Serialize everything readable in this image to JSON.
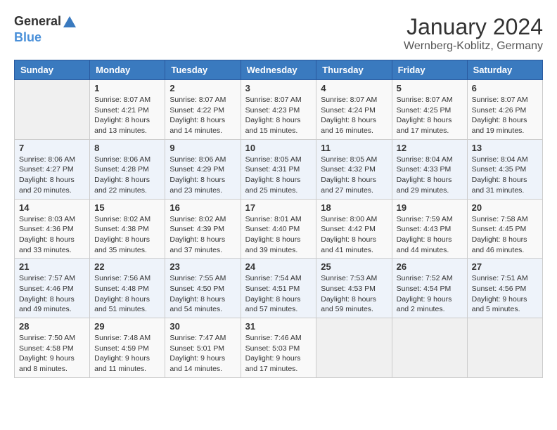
{
  "header": {
    "logo_general": "General",
    "logo_blue": "Blue",
    "month_title": "January 2024",
    "location": "Wernberg-Koblitz, Germany"
  },
  "days_of_week": [
    "Sunday",
    "Monday",
    "Tuesday",
    "Wednesday",
    "Thursday",
    "Friday",
    "Saturday"
  ],
  "weeks": [
    [
      {
        "day": "",
        "info": ""
      },
      {
        "day": "1",
        "info": "Sunrise: 8:07 AM\nSunset: 4:21 PM\nDaylight: 8 hours\nand 13 minutes."
      },
      {
        "day": "2",
        "info": "Sunrise: 8:07 AM\nSunset: 4:22 PM\nDaylight: 8 hours\nand 14 minutes."
      },
      {
        "day": "3",
        "info": "Sunrise: 8:07 AM\nSunset: 4:23 PM\nDaylight: 8 hours\nand 15 minutes."
      },
      {
        "day": "4",
        "info": "Sunrise: 8:07 AM\nSunset: 4:24 PM\nDaylight: 8 hours\nand 16 minutes."
      },
      {
        "day": "5",
        "info": "Sunrise: 8:07 AM\nSunset: 4:25 PM\nDaylight: 8 hours\nand 17 minutes."
      },
      {
        "day": "6",
        "info": "Sunrise: 8:07 AM\nSunset: 4:26 PM\nDaylight: 8 hours\nand 19 minutes."
      }
    ],
    [
      {
        "day": "7",
        "info": ""
      },
      {
        "day": "8",
        "info": "Sunrise: 8:06 AM\nSunset: 4:28 PM\nDaylight: 8 hours\nand 22 minutes."
      },
      {
        "day": "9",
        "info": "Sunrise: 8:06 AM\nSunset: 4:29 PM\nDaylight: 8 hours\nand 23 minutes."
      },
      {
        "day": "10",
        "info": "Sunrise: 8:05 AM\nSunset: 4:31 PM\nDaylight: 8 hours\nand 25 minutes."
      },
      {
        "day": "11",
        "info": "Sunrise: 8:05 AM\nSunset: 4:32 PM\nDaylight: 8 hours\nand 27 minutes."
      },
      {
        "day": "12",
        "info": "Sunrise: 8:04 AM\nSunset: 4:33 PM\nDaylight: 8 hours\nand 29 minutes."
      },
      {
        "day": "13",
        "info": "Sunrise: 8:04 AM\nSunset: 4:35 PM\nDaylight: 8 hours\nand 31 minutes."
      }
    ],
    [
      {
        "day": "14",
        "info": "Sunrise: 8:03 AM\nSunset: 4:36 PM\nDaylight: 8 hours\nand 33 minutes."
      },
      {
        "day": "15",
        "info": "Sunrise: 8:02 AM\nSunset: 4:38 PM\nDaylight: 8 hours\nand 35 minutes."
      },
      {
        "day": "16",
        "info": "Sunrise: 8:02 AM\nSunset: 4:39 PM\nDaylight: 8 hours\nand 37 minutes."
      },
      {
        "day": "17",
        "info": "Sunrise: 8:01 AM\nSunset: 4:40 PM\nDaylight: 8 hours\nand 39 minutes."
      },
      {
        "day": "18",
        "info": "Sunrise: 8:00 AM\nSunset: 4:42 PM\nDaylight: 8 hours\nand 41 minutes."
      },
      {
        "day": "19",
        "info": "Sunrise: 7:59 AM\nSunset: 4:43 PM\nDaylight: 8 hours\nand 44 minutes."
      },
      {
        "day": "20",
        "info": "Sunrise: 7:58 AM\nSunset: 4:45 PM\nDaylight: 8 hours\nand 46 minutes."
      }
    ],
    [
      {
        "day": "21",
        "info": "Sunrise: 7:57 AM\nSunset: 4:46 PM\nDaylight: 8 hours\nand 49 minutes."
      },
      {
        "day": "22",
        "info": "Sunrise: 7:56 AM\nSunset: 4:48 PM\nDaylight: 8 hours\nand 51 minutes."
      },
      {
        "day": "23",
        "info": "Sunrise: 7:55 AM\nSunset: 4:50 PM\nDaylight: 8 hours\nand 54 minutes."
      },
      {
        "day": "24",
        "info": "Sunrise: 7:54 AM\nSunset: 4:51 PM\nDaylight: 8 hours\nand 57 minutes."
      },
      {
        "day": "25",
        "info": "Sunrise: 7:53 AM\nSunset: 4:53 PM\nDaylight: 8 hours\nand 59 minutes."
      },
      {
        "day": "26",
        "info": "Sunrise: 7:52 AM\nSunset: 4:54 PM\nDaylight: 9 hours\nand 2 minutes."
      },
      {
        "day": "27",
        "info": "Sunrise: 7:51 AM\nSunset: 4:56 PM\nDaylight: 9 hours\nand 5 minutes."
      }
    ],
    [
      {
        "day": "28",
        "info": "Sunrise: 7:50 AM\nSunset: 4:58 PM\nDaylight: 9 hours\nand 8 minutes."
      },
      {
        "day": "29",
        "info": "Sunrise: 7:48 AM\nSunset: 4:59 PM\nDaylight: 9 hours\nand 11 minutes."
      },
      {
        "day": "30",
        "info": "Sunrise: 7:47 AM\nSunset: 5:01 PM\nDaylight: 9 hours\nand 14 minutes."
      },
      {
        "day": "31",
        "info": "Sunrise: 7:46 AM\nSunset: 5:03 PM\nDaylight: 9 hours\nand 17 minutes."
      },
      {
        "day": "",
        "info": ""
      },
      {
        "day": "",
        "info": ""
      },
      {
        "day": "",
        "info": ""
      }
    ]
  ],
  "week7_sunday": {
    "day": "7",
    "info": "Sunrise: 8:06 AM\nSunset: 4:27 PM\nDaylight: 8 hours\nand 20 minutes."
  }
}
